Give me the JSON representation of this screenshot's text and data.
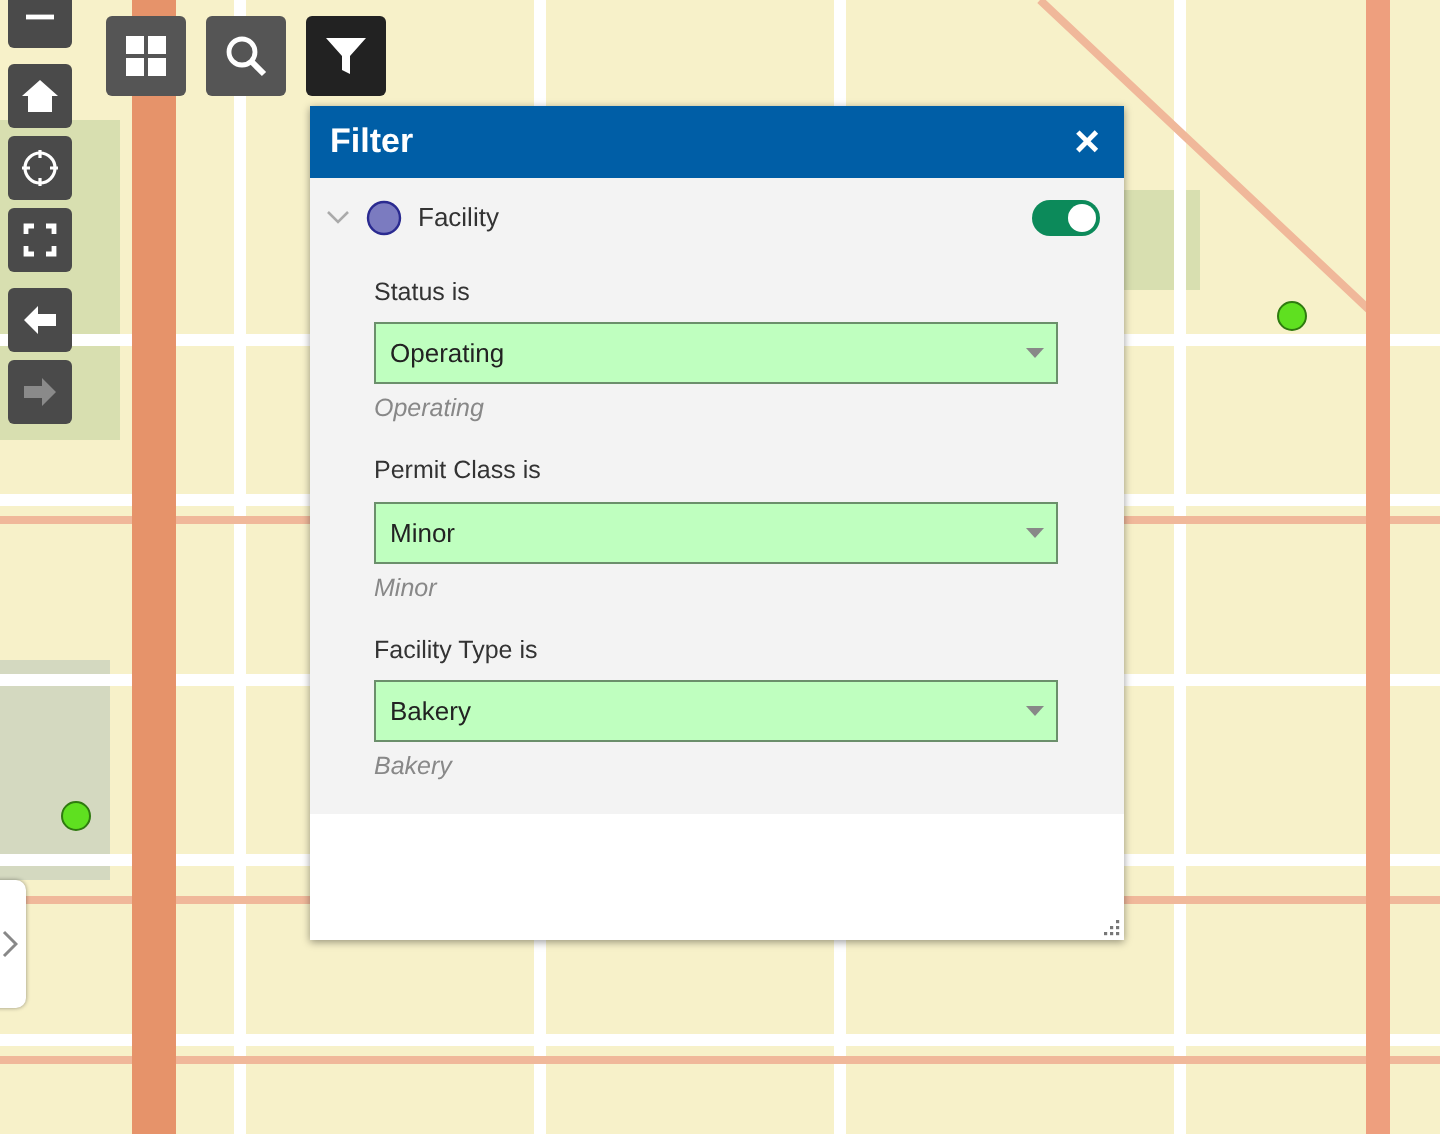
{
  "map_tools": [
    {
      "kind": "zoom-out",
      "disabled": false
    },
    {
      "kind": "home",
      "disabled": false
    },
    {
      "kind": "locate",
      "disabled": false
    },
    {
      "kind": "extent",
      "disabled": false
    },
    {
      "kind": "back",
      "disabled": false
    },
    {
      "kind": "forward",
      "disabled": true
    }
  ],
  "widgets": [
    {
      "kind": "gallery",
      "selected": false
    },
    {
      "kind": "search",
      "selected": false
    },
    {
      "kind": "filter",
      "selected": true
    }
  ],
  "panel": {
    "title": "Filter",
    "close": "×"
  },
  "layer": {
    "name": "Facility",
    "expanded": true,
    "on": true,
    "color": "#7b7bc0"
  },
  "filters": [
    {
      "label": "Status is",
      "value": "Operating",
      "hint": "Operating"
    },
    {
      "label": "Permit Class is",
      "value": "Minor",
      "hint": "Minor"
    },
    {
      "label": "Facility Type is",
      "value": "Bakery",
      "hint": "Bakery"
    }
  ]
}
